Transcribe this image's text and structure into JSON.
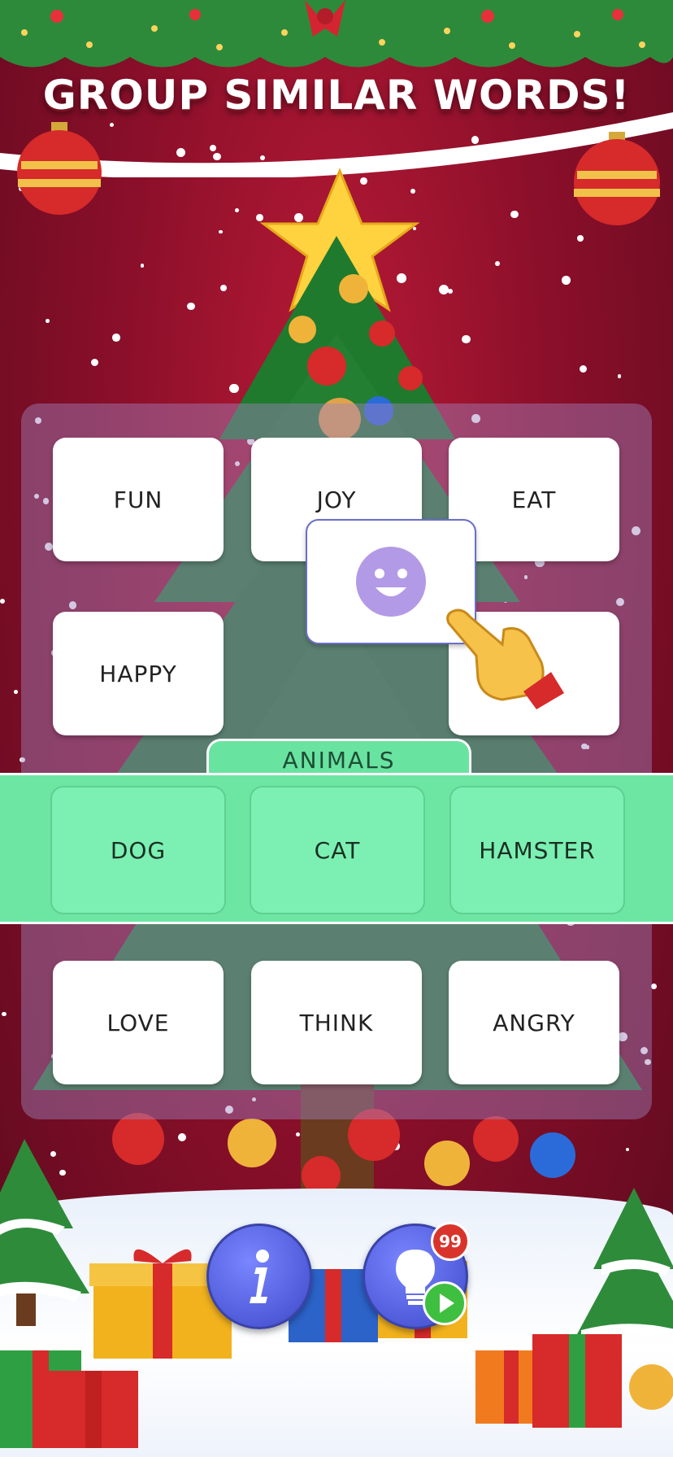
{
  "title": "GROUP SIMILAR WORDS!",
  "board": {
    "row1": [
      "FUN",
      "JOY",
      "EAT"
    ],
    "row2": [
      "HAPPY",
      ""
    ],
    "row3": [
      "LOVE",
      "THINK",
      "ANGRY"
    ],
    "dragging_tile_icon": "smiley-face-icon"
  },
  "group": {
    "category": "ANIMALS",
    "words": [
      "DOG",
      "CAT",
      "HAMSTER"
    ]
  },
  "buttons": {
    "info_icon": "info-icon",
    "hint_icon": "lightbulb-icon",
    "hint_count": "99",
    "video_icon": "play-icon"
  },
  "colors": {
    "background": "#8b0f2a",
    "group_green": "#6de6a4",
    "button_blue": "#4f5bd9",
    "badge_red": "#d9342b",
    "smile_purple": "#b39ae6"
  }
}
